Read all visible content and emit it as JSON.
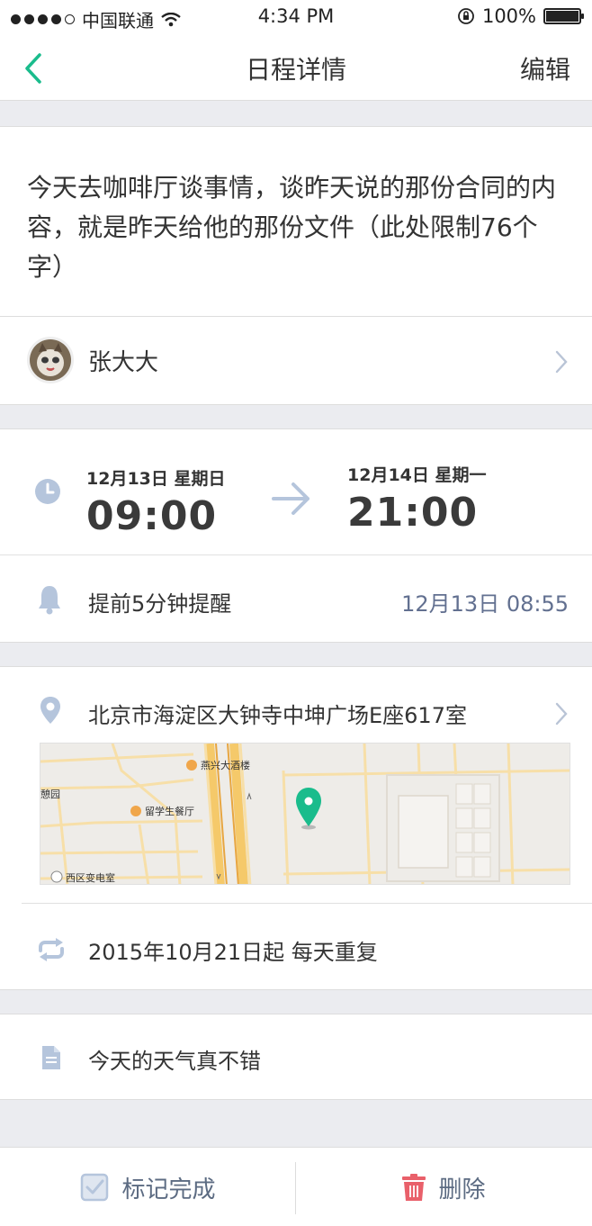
{
  "status_bar": {
    "carrier": "中国联通",
    "time": "4:34 PM",
    "battery": "100%"
  },
  "nav": {
    "title": "日程详情",
    "edit_label": "编辑"
  },
  "event": {
    "description": "今天去咖啡厅谈事情，谈昨天说的那份合同的内容，就是昨天给他的那份文件（此处限制76个字）",
    "owner": "张大大"
  },
  "time": {
    "start_date": "12月13日 星期日",
    "start_time": "09:00",
    "end_date": "12月14日 星期一",
    "end_time": "21:00"
  },
  "reminder": {
    "label": "提前5分钟提醒",
    "time": "12月13日 08:55"
  },
  "location": {
    "address": "北京市海淀区大钟寺中坤广场E座617室",
    "map_labels": {
      "hotel": "燕兴大酒楼",
      "restaurant": "留学生餐厅",
      "garden": "憩园",
      "substation": "西区变电室"
    }
  },
  "repeat": {
    "label": "2015年10月21日起 每天重复"
  },
  "note": {
    "text": "今天的天气真不错"
  },
  "actions": {
    "complete_label": "标记完成",
    "delete_label": "删除"
  },
  "colors": {
    "accent": "#1abc8c",
    "icon": "#b5c5dc",
    "delete": "#e9606a",
    "secondary_text": "#627090"
  }
}
